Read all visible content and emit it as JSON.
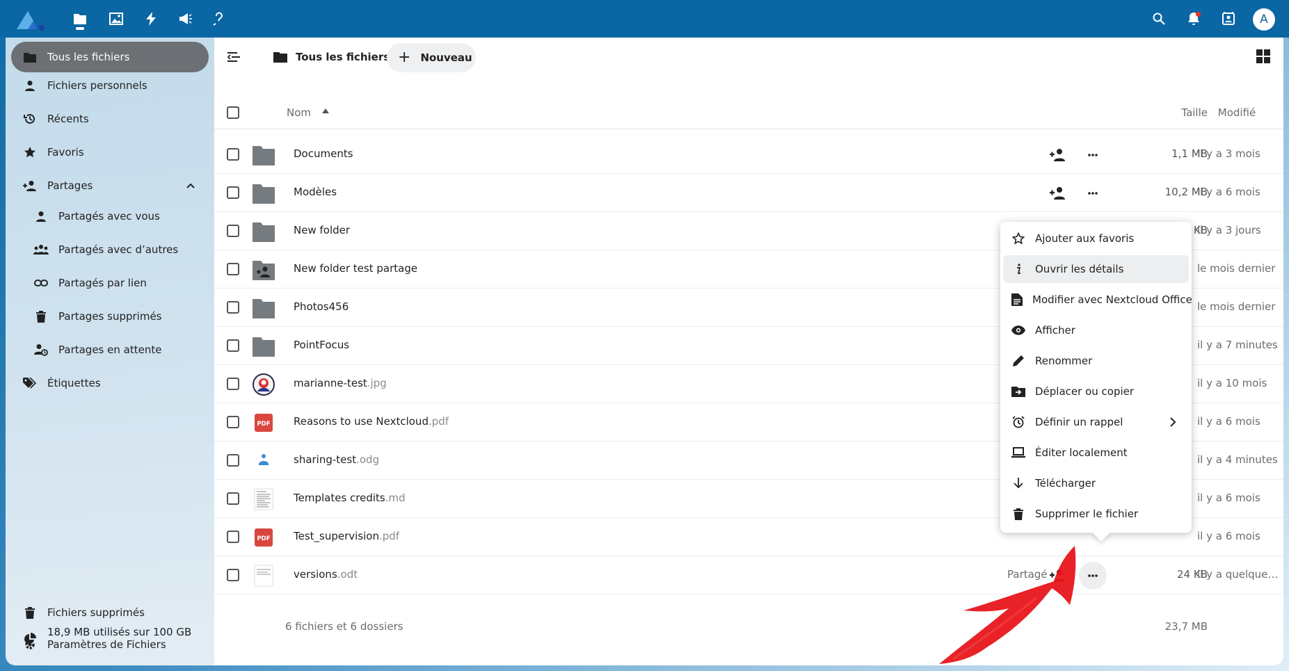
{
  "topbar": {
    "apps": [
      "files-icon",
      "photos-icon",
      "activity-icon",
      "announcements-icon",
      "help-icon"
    ],
    "avatar_letter": "A"
  },
  "sidebar": {
    "items": [
      {
        "label": "Tous les fichiers"
      },
      {
        "label": "Fichiers personnels"
      },
      {
        "label": "Récents"
      },
      {
        "label": "Favoris"
      },
      {
        "label": "Partages"
      },
      {
        "label": "Partagés avec vous"
      },
      {
        "label": "Partagés avec d’autres"
      },
      {
        "label": "Partagés par lien"
      },
      {
        "label": "Partages supprimés"
      },
      {
        "label": "Partages en attente"
      },
      {
        "label": "Étiquettes"
      }
    ],
    "footer": {
      "trash": "Fichiers supprimés",
      "quota": "18,9 MB utilisés sur 100 GB",
      "settings": "Paramètres de Fichiers"
    }
  },
  "toolbar": {
    "breadcrumb": "Tous les fichiers",
    "new_label": "Nouveau"
  },
  "table": {
    "headers": {
      "name": "Nom",
      "size": "Taille",
      "modified": "Modifié"
    },
    "rows": [
      {
        "name": "Documents",
        "ext": "",
        "size": "1,1 MB",
        "modified": "il y a 3 mois"
      },
      {
        "name": "Modèles",
        "ext": "",
        "size": "10,2 MB",
        "modified": "il y a 6 mois"
      },
      {
        "name": "New folder",
        "ext": "",
        "size": "0 KB",
        "modified": "il y a 3 jours"
      },
      {
        "name": "New folder test partage",
        "ext": "",
        "size": "",
        "modified": "le mois dernier"
      },
      {
        "name": "Photos456",
        "ext": "",
        "size": "",
        "modified": "le mois dernier"
      },
      {
        "name": "PointFocus",
        "ext": "",
        "size": "",
        "modified": "il y a 7 minutes"
      },
      {
        "name": "marianne-test",
        "ext": ".jpg",
        "size": "",
        "modified": "il y a 10 mois"
      },
      {
        "name": "Reasons to use Nextcloud",
        "ext": ".pdf",
        "size": "",
        "modified": "il y a 6 mois"
      },
      {
        "name": "sharing-test",
        "ext": ".odg",
        "size": "",
        "modified": "il y a 4 minutes"
      },
      {
        "name": "Templates credits",
        "ext": ".md",
        "size": "",
        "modified": "il y a 6 mois"
      },
      {
        "name": "Test_supervision",
        "ext": ".pdf",
        "size": "",
        "modified": "il y a 6 mois"
      },
      {
        "name": "versions",
        "ext": ".odt",
        "size": "24 KB",
        "modified": "il y a quelques…",
        "shared_label": "Partagé"
      }
    ],
    "summary": {
      "text": "6 fichiers et 6 dossiers",
      "total": "23,7 MB"
    }
  },
  "context_menu": {
    "items": [
      {
        "label": "Ajouter aux favoris"
      },
      {
        "label": "Ouvrir les détails"
      },
      {
        "label": "Modifier avec Nextcloud Office"
      },
      {
        "label": "Afficher"
      },
      {
        "label": "Renommer"
      },
      {
        "label": "Déplacer ou copier"
      },
      {
        "label": "Définir un rappel"
      },
      {
        "label": "Éditer localement"
      },
      {
        "label": "Télécharger"
      },
      {
        "label": "Supprimer le fichier"
      }
    ]
  },
  "colors": {
    "header": "#0b66a4",
    "active_nav": "#6c6f73",
    "pdf_red": "#d9463e",
    "annotation_red": "#e8161b"
  }
}
